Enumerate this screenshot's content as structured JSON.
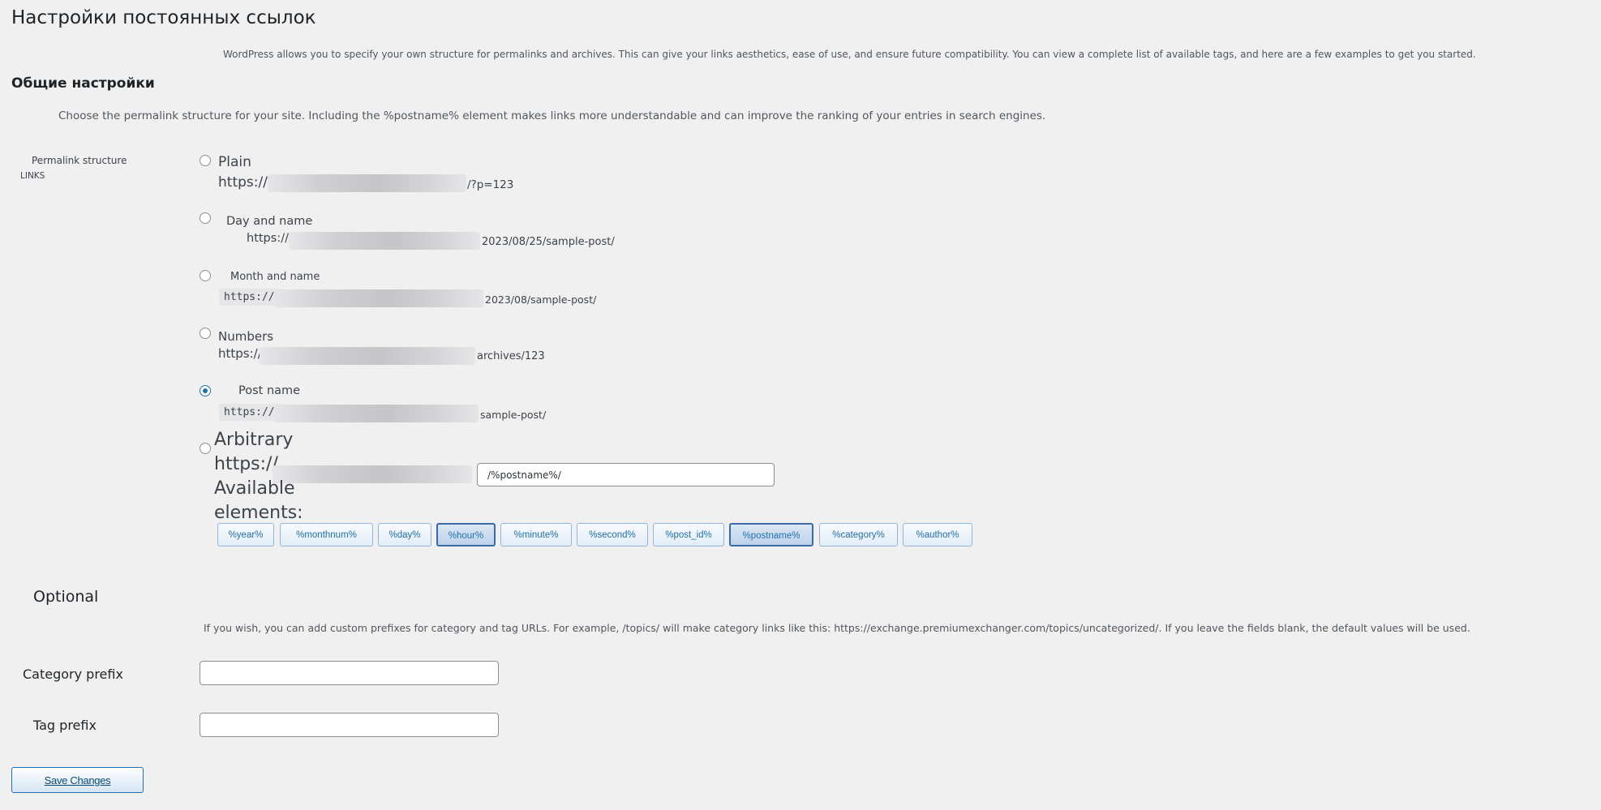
{
  "page": {
    "title": "Настройки постоянных ссылок",
    "intro": "WordPress allows you to specify your own structure for permalinks and archives. This can give your links aesthetics, ease of use, and ensure future compatibility. You can view a complete list of available tags, and here are a few examples to get you started."
  },
  "common": {
    "heading": "Общие настройки",
    "description": "Choose the permalink structure for your site. Including the %postname% element makes links more understandable and can improve the ranking of your entries in search engines.",
    "row_label": "Permalink structure",
    "row_sublabel": "LINKS"
  },
  "options": {
    "plain": {
      "label": "Plain",
      "prefix": "https://",
      "suffix": "/?p=123"
    },
    "day_name": {
      "label": "Day and name",
      "prefix": "https://",
      "suffix": "2023/08/25/sample-post/"
    },
    "month_name": {
      "label": "Month and name",
      "prefix": "https://",
      "suffix": "2023/08/sample-post/"
    },
    "numbers": {
      "label": "Numbers",
      "prefix": "https://",
      "suffix": "archives/123"
    },
    "post_name": {
      "label": "Post name",
      "prefix": "https://",
      "suffix": "sample-post/"
    },
    "custom": {
      "label": "Arbitrary",
      "prefix": "https://",
      "value": "/%postname%/",
      "available_label": "Available",
      "available_label_2": "elements:"
    },
    "selected": "post_name"
  },
  "tags": [
    "%year%",
    "%monthnum%",
    "%day%",
    "%hour%",
    "%minute%",
    "%second%",
    "%post_id%",
    "%postname%",
    "%category%",
    "%author%"
  ],
  "optional": {
    "heading": "Optional",
    "description": "If you wish, you can add custom prefixes for category and tag URLs. For example, /topics/ will make category links like this: https://exchange.premiumexchanger.com/topics/uncategorized/. If you leave the fields blank, the default values will be used.",
    "category_label": "Category prefix",
    "category_value": "",
    "tag_label": "Tag prefix",
    "tag_value": ""
  },
  "actions": {
    "save_label": "Save Changes"
  },
  "colors": {
    "accent": "#2271b1",
    "background": "#f0f0f1",
    "text": "#3c434a"
  }
}
